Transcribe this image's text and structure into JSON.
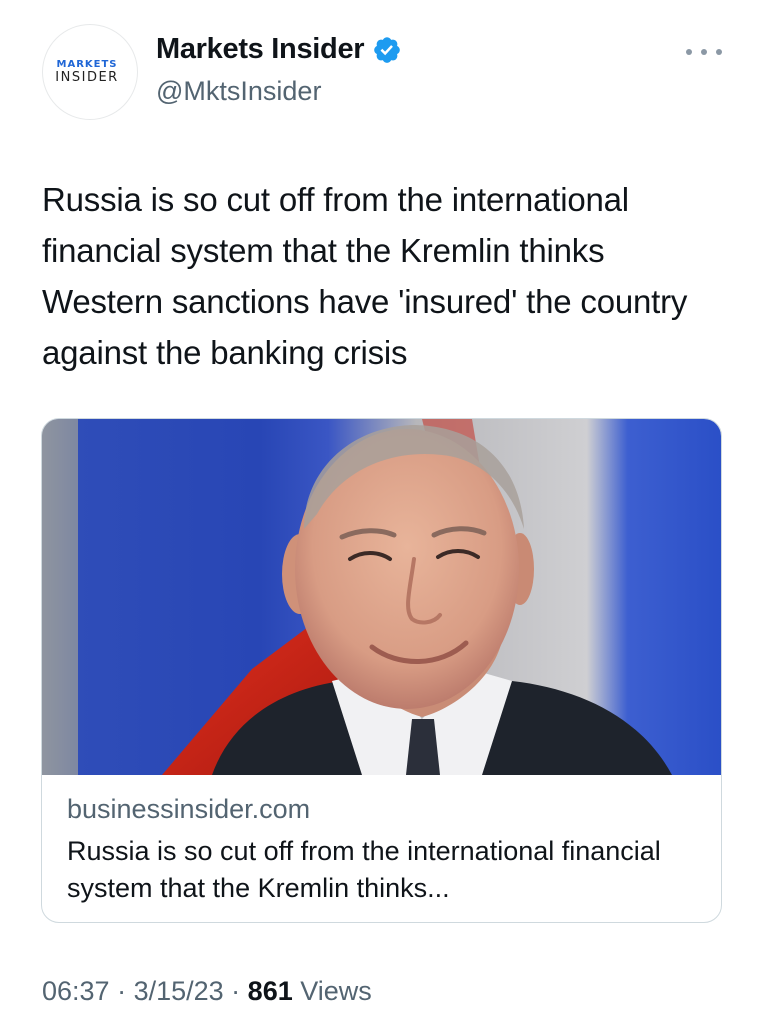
{
  "author": {
    "avatar_line1": "MARKETS",
    "avatar_line2": "INSIDER",
    "display_name": "Markets Insider",
    "handle": "@MktsInsider",
    "verified_icon": "verified-badge-icon",
    "verified_color": "#1d9bf0"
  },
  "tweet": {
    "text": "Russia is so cut off from the international financial system that the Kremlin thinks Western sanctions have 'insured' the country against the banking crisis"
  },
  "link_card": {
    "image_icon": "photo-of-man-in-suit-before-flags",
    "domain": "businessinsider.com",
    "title": "Russia is so cut off from the international financial system that the Kremlin thinks..."
  },
  "meta": {
    "time": "06:37",
    "separator": " · ",
    "date": "3/15/23",
    "views_count": "861",
    "views_label": " Views"
  },
  "more_icon": "more-options-icon"
}
